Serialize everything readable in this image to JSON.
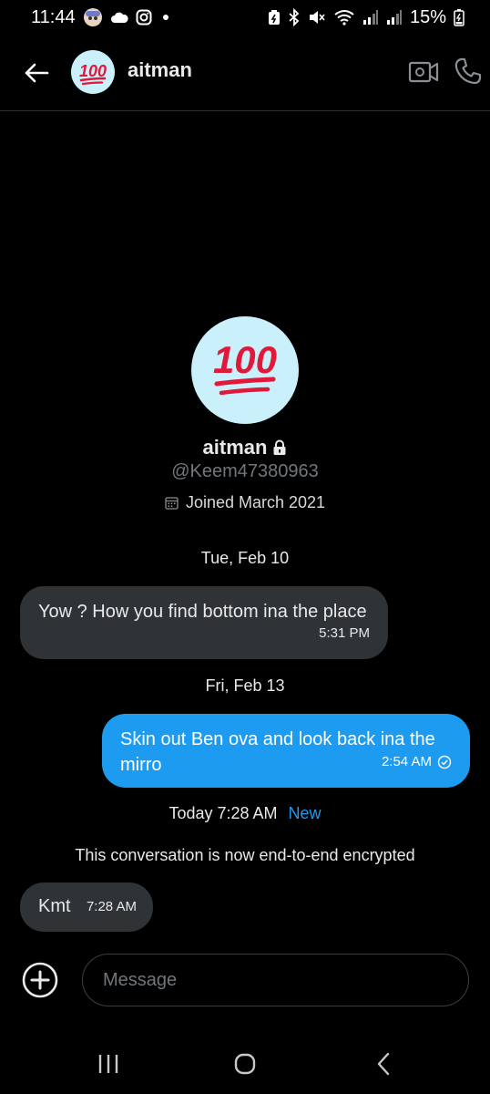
{
  "status_bar": {
    "time": "11:44",
    "battery": "15%",
    "icons_left": [
      "avatar-notification-icon",
      "cloud-icon",
      "instagram-icon",
      "dot-icon"
    ],
    "icons_right": [
      "battery-saver-icon",
      "bluetooth-icon",
      "mute-icon",
      "wifi-icon",
      "signal-icon",
      "signal-icon-2",
      "battery-icon"
    ]
  },
  "header": {
    "back_icon": "arrow-left-icon",
    "avatar_text": "100",
    "name": "aitman",
    "video_icon": "video-call-icon",
    "phone_icon": "phone-icon"
  },
  "profile": {
    "avatar_text": "100",
    "name": "aitman",
    "lock_icon": "lock-icon",
    "handle": "@Keem47380963",
    "joined": "Joined March 2021",
    "calendar_icon": "calendar-icon"
  },
  "messages": [
    {
      "date_label": "Tue, Feb 10"
    },
    {
      "direction": "in",
      "text": "Yow ? How you find bottom ina the place",
      "time": "5:31 PM"
    },
    {
      "date_label": "Fri, Feb 13"
    },
    {
      "direction": "out",
      "text": "Skin out Ben ova and look back ina the mirro",
      "time": "2:54 AM",
      "status_icon": "sent-check-icon"
    },
    {
      "direction": "in",
      "text": "Kmt",
      "time": "7:28 AM"
    }
  ],
  "today_row": {
    "label": "Today 7:28 AM",
    "new_label": "New"
  },
  "encryption_note": "This conversation is now end-to-end encrypted",
  "composer": {
    "placeholder": "Message",
    "add_icon": "plus-circle-icon"
  },
  "colors": {
    "accent": "#1d9bf0",
    "incoming_bubble": "#2f3336",
    "background": "#000000",
    "avatar_bg": "#c9f0fb",
    "emoji_red": "#e0183a"
  }
}
